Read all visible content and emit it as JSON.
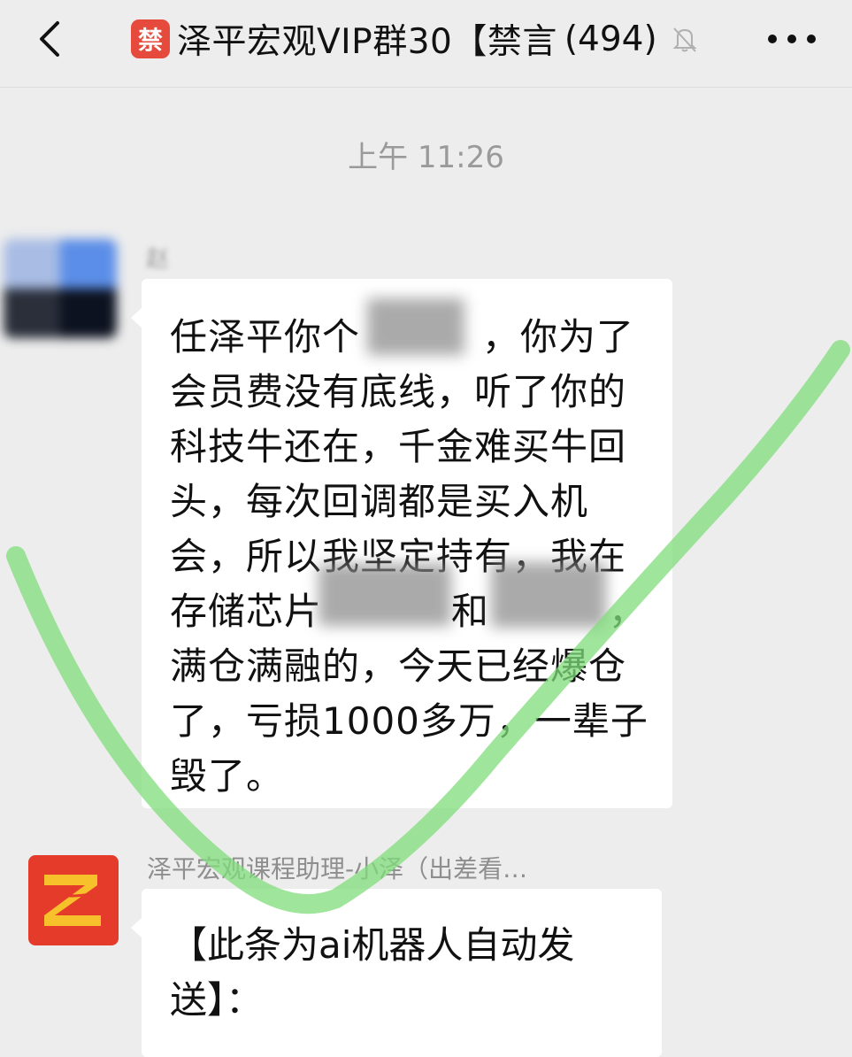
{
  "header": {
    "ban_badge": "禁",
    "title": "泽平宏观VIP群30【禁言",
    "member_count": "(494)",
    "icons": [
      "back-arrow-icon",
      "mute-bell-icon",
      "more-icon"
    ]
  },
  "chat": {
    "time": "上午 11:26",
    "messages": [
      {
        "sender": "赵",
        "lines": [
          "任泽平你个",
          "，你为了",
          "会员费没有底线，听了你的",
          "科技牛还在，千金难买牛回",
          "头，每次回调都是买入机",
          "会，所以我坚定持有，我在",
          "存储芯片",
          "和",
          "，",
          "满仓满融的，今天已经爆仓",
          "了，亏损1000多万，一辈子",
          "毁了。"
        ]
      },
      {
        "sender": "泽平宏观课程助理-小泽（出差看…",
        "lines": [
          "【此条为ai机器人自动发",
          "送】："
        ]
      }
    ]
  },
  "overlay": {
    "check_color": "#7fdc7a"
  }
}
